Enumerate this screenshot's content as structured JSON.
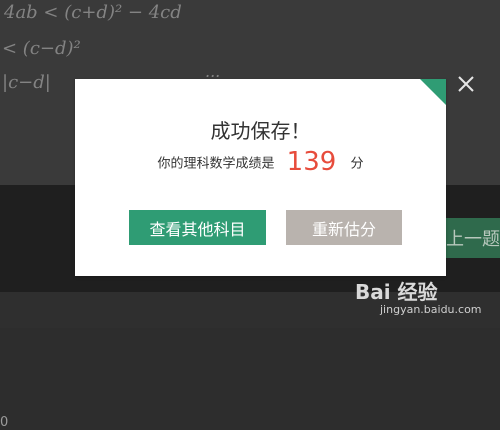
{
  "background": {
    "math_lines": [
      "4ab < (c+d)² − 4cd",
      "< (c−d)²",
      "|c−d|",
      "..."
    ],
    "left_number": "0",
    "prev_button_label": "上一题"
  },
  "modal": {
    "title": "成功保存！",
    "score_label": "你的理科数学成绩是",
    "score_value": "139",
    "score_unit": "分",
    "primary_button": "查看其他科目",
    "secondary_button": "重新估分"
  },
  "watermark": {
    "brand": "Bai 经验",
    "url": "jingyan.baidu.com"
  },
  "colors": {
    "accent": "#2f9c74",
    "score": "#e74c3c",
    "secondary_button": "#b9b3ae"
  }
}
